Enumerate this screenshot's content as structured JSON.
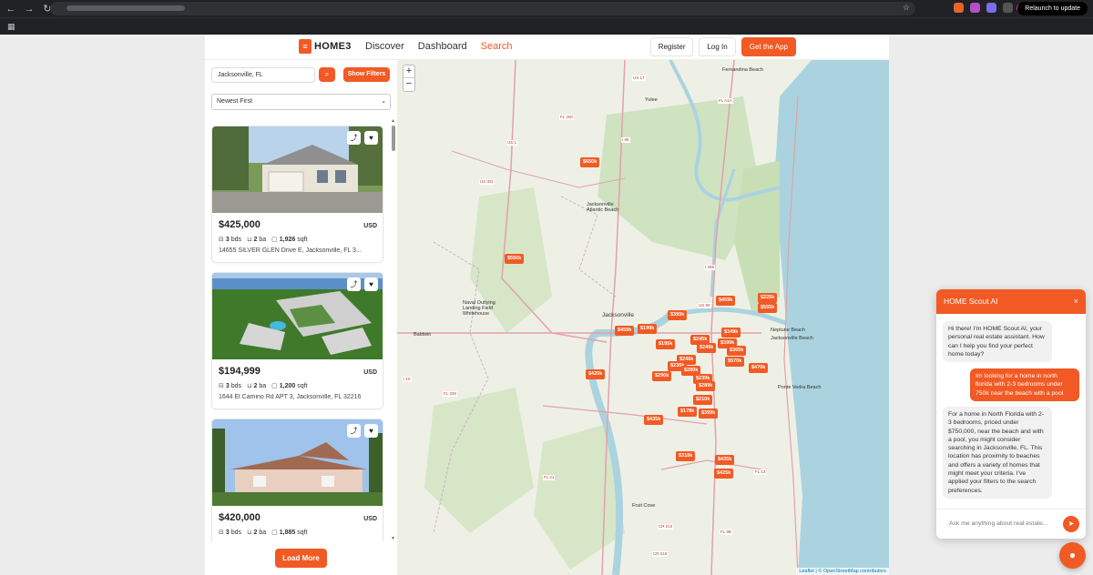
{
  "browser": {
    "relaunch_label": "Relaunch to update",
    "avatar_initial": "M"
  },
  "header": {
    "logo_text": "HOME3",
    "nav": [
      "Discover",
      "Dashboard",
      "Search"
    ],
    "active_nav": "Search",
    "register_label": "Register",
    "login_label": "Log In",
    "get_app_label": "Get the App"
  },
  "sidebar": {
    "search_value": "Jacksonville, FL",
    "show_filters_label": "Show Filters",
    "sort_value": "Newest First",
    "load_more_label": "Load More",
    "listings": [
      {
        "price": "$425,000",
        "currency": "USD",
        "beds": "3",
        "beds_unit": "bds",
        "baths": "2",
        "baths_unit": "ba",
        "sqft": "1,926",
        "sqft_unit": "sqft",
        "address": "14655 SILVER GLEN Drive E, Jacksonville, FL 3..."
      },
      {
        "price": "$194,999",
        "currency": "USD",
        "beds": "3",
        "beds_unit": "bds",
        "baths": "2",
        "baths_unit": "ba",
        "sqft": "1,200",
        "sqft_unit": "sqft",
        "address": "1644 El Camino Rd APT 3, Jacksonville, FL 32216"
      },
      {
        "price": "$420,000",
        "currency": "USD",
        "beds": "3",
        "beds_unit": "bds",
        "baths": "2",
        "baths_unit": "ba",
        "sqft": "1,885",
        "sqft_unit": "sqft",
        "address": ""
      }
    ]
  },
  "map": {
    "zoom_in": "+",
    "zoom_out": "−",
    "attribution_leaflet": "Leaflet",
    "attribution_rest": " | © OpenStreetMap contributors",
    "place_labels": [
      "Jacksonville",
      "Neptune Beach",
      "Jacksonville Beach",
      "Ponte Vedra Beach",
      "Yulee",
      "Fernandina Beach",
      "Baldwin",
      "Fruit Cove",
      "Jacksonville Atlantic Beach",
      "Naval Outlying Landing Field Whitehouse"
    ],
    "route_labels": [
      "US 17",
      "FL A1A",
      "US 1",
      "US 301",
      "FL 200",
      "I 95",
      "I 10",
      "FL 21",
      "CR 210",
      "FL 228",
      "US 90",
      "FL 13",
      "CR 218",
      "I 295",
      "FL 9B"
    ],
    "price_pins": [
      "$650k",
      "$550k",
      "$459k",
      "$225k",
      "$555k",
      "$399k",
      "$459k",
      "$199k",
      "$245k",
      "$349k",
      "$195k",
      "$249k",
      "$399k",
      "$365k",
      "$246k",
      "$570k",
      "$470k",
      "$420k",
      "$230k",
      "$290k",
      "$280k",
      "$239k",
      "$289k",
      "$210k",
      "$178k",
      "$399k",
      "$435k",
      "$318k",
      "$435k",
      "$425k"
    ]
  },
  "chat": {
    "title": "HOME Scout AI",
    "close_label": "×",
    "messages": [
      {
        "role": "ai",
        "text": "Hi there! I'm HOME Scout AI, your personal real estate assistant. How can I help you find your perfect home today?"
      },
      {
        "role": "user",
        "text": "Im looking for a home in north florida with 2-3 bedrooms under 750k near the beach with a pool"
      },
      {
        "role": "ai",
        "text": "For a home in North Florida with 2-3 bedrooms, priced under $750,000, near the beach and with a pool, you might consider searching in Jacksonville, FL. This location has proximity to beaches and offers a variety of homes that might meet your criteria. I've applied your filters to the search preferences."
      }
    ],
    "input_placeholder": "Ask me anything about real estate..."
  },
  "colors": {
    "accent": "#f15a24",
    "water": "#aad3df",
    "land": "#eef0e6"
  }
}
